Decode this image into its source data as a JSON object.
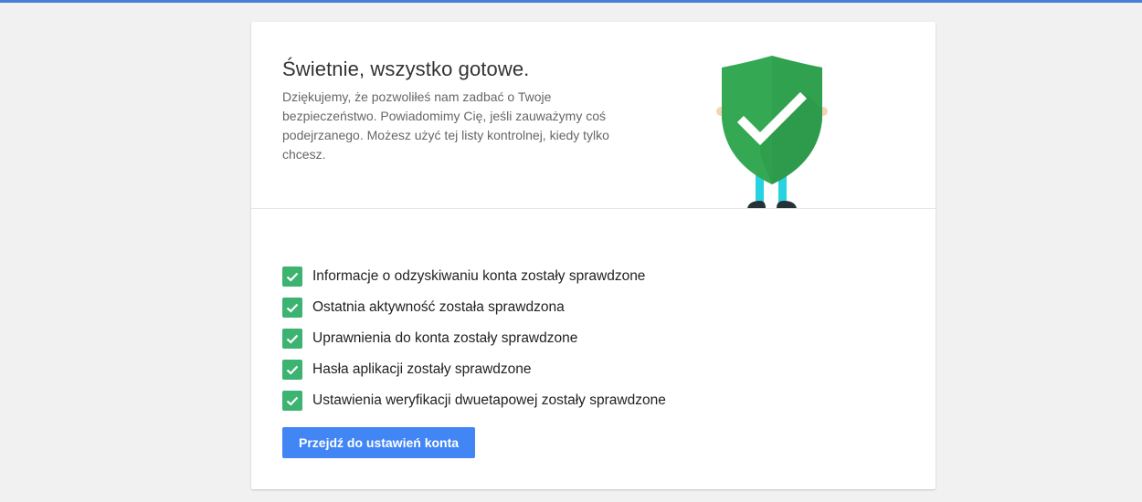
{
  "colors": {
    "top_accent": "#4a7fd9",
    "shield_green": "#34a853",
    "check_green": "#3cb371",
    "button_blue": "#4285f4"
  },
  "header": {
    "title": "Świetnie, wszystko gotowe.",
    "description": "Dziękujemy, że pozwoliłeś nam zadbać o Twoje bezpieczeństwo. Powiadomimy Cię, jeśli zauważymy coś podejrzanego. Możesz użyć tej listy kontrolnej, kiedy tylko chcesz."
  },
  "illustration": {
    "icon": "security-shield-check-icon"
  },
  "checklist": {
    "items": [
      {
        "label": "Informacje o odzyskiwaniu konta zostały sprawdzone",
        "checked": true
      },
      {
        "label": "Ostatnia aktywność została sprawdzona",
        "checked": true
      },
      {
        "label": "Uprawnienia do konta zostały sprawdzone",
        "checked": true
      },
      {
        "label": "Hasła aplikacji zostały sprawdzone",
        "checked": true
      },
      {
        "label": "Ustawienia weryfikacji dwuetapowej zostały sprawdzone",
        "checked": true
      }
    ]
  },
  "actions": {
    "go_to_settings_label": "Przejdź do ustawień konta"
  }
}
